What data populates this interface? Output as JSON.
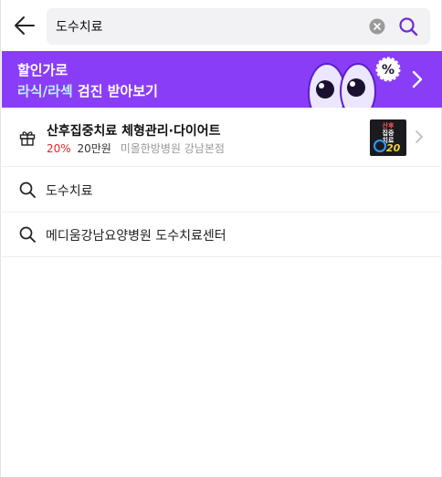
{
  "search": {
    "value": "도수치료",
    "placeholder": ""
  },
  "banner": {
    "line1": "할인가로",
    "line2_highlight": "라식/라섹",
    "line2_rest": " 검진 받아보기",
    "badge": "%"
  },
  "ad": {
    "title": "산후집중치료 체형관리·다이어트",
    "discount": "20%",
    "price": "20만원",
    "clinic": "미올한방병원 강남본점",
    "thumb": {
      "line1": "산후",
      "line2": "집중",
      "line3": "치료",
      "number": "20"
    }
  },
  "suggestions": [
    {
      "text": "도수치료"
    },
    {
      "text": "메디움강남요양병원 도수치료센터"
    }
  ],
  "colors": {
    "accent": "#6c2bd9",
    "banner_bg": "#8a3df6",
    "discount": "#e5252a"
  }
}
